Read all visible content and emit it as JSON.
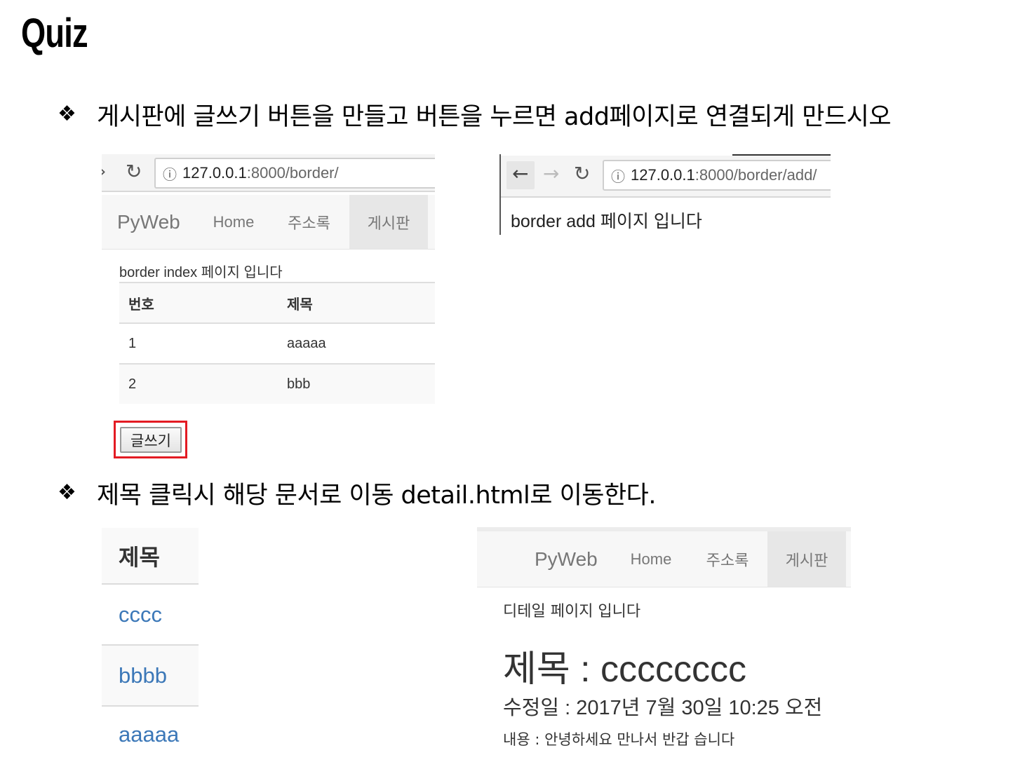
{
  "page": {
    "title": "Quiz",
    "bullet_symbol": "❖",
    "instructions": [
      "게시판에 글쓰기 버튼을 만들고 버튼을 누르면 add페이지로 연결되게 만드시오",
      "제목 클릭시 해당 문서로 이동 detail.html로 이동한다."
    ]
  },
  "shot_index": {
    "url_host": "127.0.0.1",
    "url_rest": ":8000/border/",
    "navbar": {
      "brand": "PyWeb",
      "links": [
        "Home",
        "주소록",
        "게시판"
      ],
      "active": "게시판"
    },
    "heading": "border index 페이지 입니다",
    "table": {
      "headers": [
        "번호",
        "제목"
      ],
      "rows": [
        [
          "1",
          "aaaaa"
        ],
        [
          "2",
          "bbb"
        ]
      ]
    },
    "write_button": "글쓰기"
  },
  "shot_add": {
    "url_host": "127.0.0.1",
    "url_rest": ":8000/border/add/",
    "body_text": "border add 페이지 입니다"
  },
  "shot_list": {
    "header": "제목",
    "items": [
      "cccc",
      "bbbb",
      "aaaaa"
    ]
  },
  "shot_detail": {
    "navbar": {
      "brand": "PyWeb",
      "links": [
        "Home",
        "주소록",
        "게시판"
      ],
      "active": "게시판"
    },
    "heading": "디테일 페이지 입니다",
    "title_line": "제목 : cccccccc",
    "modified_line": "수정일 : 2017년 7월 30일 10:25 오전",
    "content_line": "내용 : 안녕하세요 만나서 반갑 습니다"
  },
  "icons": {
    "back": "back-arrow-icon",
    "forward": "forward-arrow-icon",
    "reload": "reload-icon",
    "info": "info-icon"
  },
  "colors": {
    "highlight_outline": "#e31b23",
    "link": "#3c78b8",
    "navbar_bg": "#f7f7f7",
    "navbar_active": "#e7e7e7"
  }
}
